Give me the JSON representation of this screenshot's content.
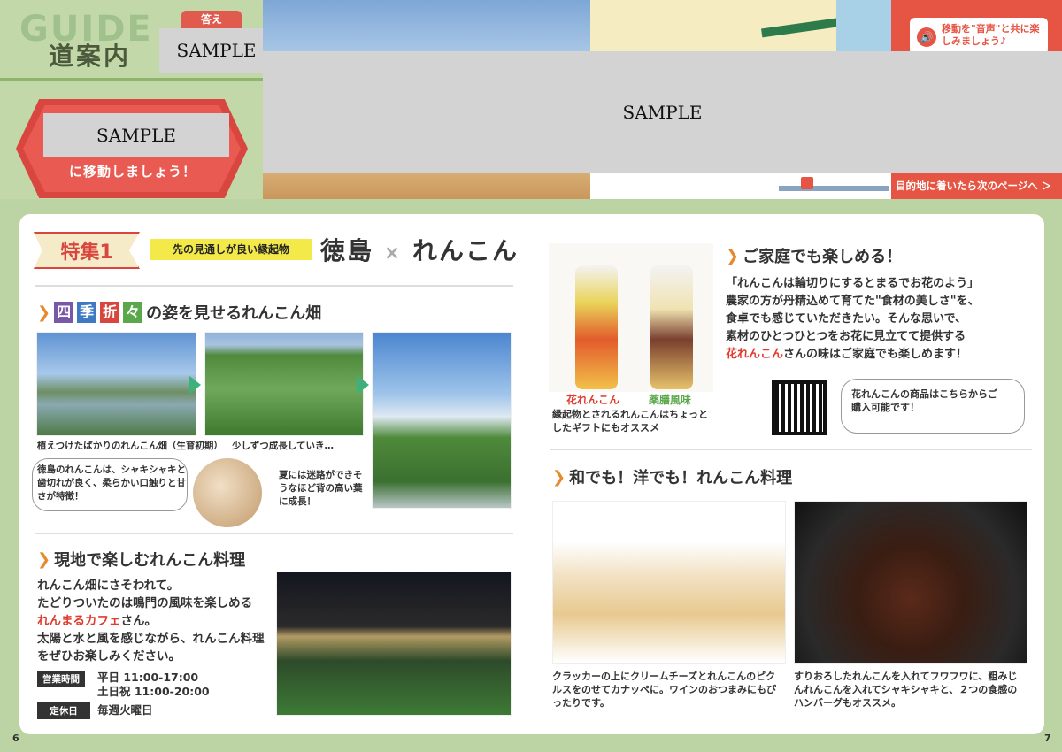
{
  "banner": {
    "guide_word": "GUIDE",
    "guide_jp": "道案内",
    "answer_tab": "答え",
    "sample_a": "SAMPLE",
    "sample_b": "SAMPLE",
    "sample_c": "SAMPLE",
    "move_text": "に移動しましょう！",
    "audio_text": "移動を\"音声\"と共に楽しみましょう♪",
    "next_page": "目的地に着いたら次のページへ ＞"
  },
  "feature": {
    "badge": "特集1",
    "pill": "先の見通しが良い縁起物",
    "title_left": "徳島",
    "title_x": "×",
    "title_right": "れんこん"
  },
  "left": {
    "seasons_chars": [
      "四",
      "季",
      "折",
      "々"
    ],
    "seasons_colors": [
      "#7a58a8",
      "#3f79c2",
      "#d9463f",
      "#5aa84a"
    ],
    "seasons_rest": "の姿を見せるれんこん畑",
    "cap1": "植えつけたばかりのれんこん畑（生育初期）",
    "cap2": "少しずつ成長していき…",
    "bubble": "徳島のれんこんは、シャキシャキと歯切れが良く、柔らかい口触りと甘さが特徴！",
    "cap3": "夏には迷路ができそうなほど背の高い葉に成長！",
    "local_head": "現地で楽しむれんこん料理",
    "local_p1": "れんこん畑にさそわれて。",
    "local_p2": "たどりついたのは鳴門の風味を楽しめる",
    "local_red": "れんまるカフェ",
    "local_p3": "さん。",
    "local_p4": "太陽と水と風を感じながら、れんこん料理をぜひお楽しみください。",
    "hours_tag": "営業時間",
    "hours_1": "平日 11:00-17:00",
    "hours_2": "土日祝 11:00-20:00",
    "closed_tag": "定休日",
    "closed": "毎週火曜日"
  },
  "right": {
    "jar1": "花れんこん",
    "jar2": "薬膳風味",
    "jar_caption": "縁起物とされるれんこんはちょっとしたギフトにもオススメ",
    "home_head": "ご家庭でも楽しめる！",
    "home_p1": "「れんこんは輪切りにするとまるでお花のよう」",
    "home_p2": "農家の方が丹精込めて育てた\"食材の美しさ\"を、",
    "home_p3": "食卓でも感じていただきたい。そんな思いで、",
    "home_p4": "素材のひとつひとつをお花に見立てて提供する",
    "home_red": "花れんこん",
    "home_p5": "さんの味はご家庭でも楽しめます！",
    "qr_text": "花れんこんの商品はこちらからご購入可能です！",
    "wayo_head": "和でも！洋でも！れんこん料理",
    "dish1": "クラッカーの上にクリームチーズとれんこんのピクルスをのせてカナッペに。ワインのおつまみにもぴったりです。",
    "dish2": "すりおろしたれんこんを入れてフワフワに、粗みじんれんこんを入れてシャキシャキと、２つの食感のハンバーグもオススメ。"
  },
  "pages": {
    "left": "6",
    "right": "7"
  }
}
